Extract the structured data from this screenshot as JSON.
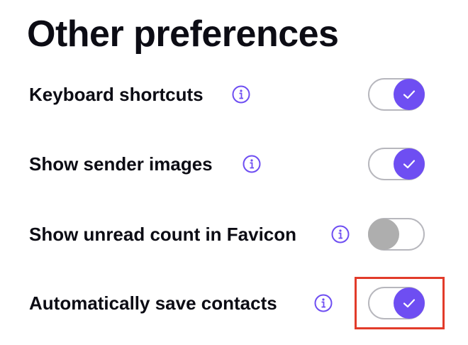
{
  "page": {
    "title": "Other preferences"
  },
  "preferences": [
    {
      "label": "Keyboard shortcuts",
      "info_icon": "info-circle-icon",
      "enabled": true
    },
    {
      "label": "Show sender images",
      "info_icon": "info-circle-icon",
      "enabled": true
    },
    {
      "label": "Show unread count in Favicon",
      "info_icon": "info-circle-icon",
      "enabled": false
    },
    {
      "label": "Automatically save contacts",
      "info_icon": "info-circle-icon",
      "enabled": true,
      "highlighted": true
    }
  ],
  "colors": {
    "accent": "#6e4ef2",
    "toggle_off_knob": "#aeaeae",
    "toggle_border": "#b7b7bd",
    "highlight_border": "#e23b2a",
    "text": "#0c0c14"
  }
}
